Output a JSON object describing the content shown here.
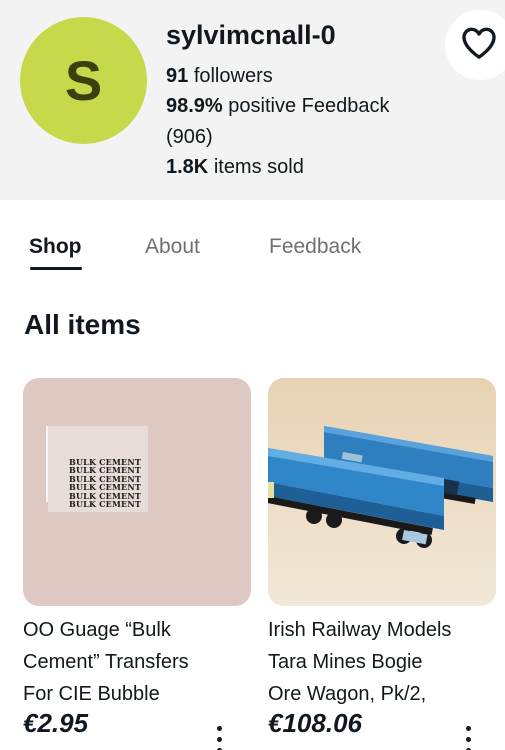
{
  "seller": {
    "avatar_initial": "S",
    "name": "sylvimcnall-0",
    "followers_count": "91",
    "followers_label": "followers",
    "feedback_percent": "98.9%",
    "feedback_label": "positive Feedback",
    "feedback_count": "(906)",
    "items_sold_count": "1.8K",
    "items_sold_label": "items sold",
    "follow_icon": "heart-outline-icon"
  },
  "tabs": [
    {
      "label": "Shop",
      "active": true
    },
    {
      "label": "About",
      "active": false
    },
    {
      "label": "Feedback",
      "active": false
    }
  ],
  "section_title": "All items",
  "listings": [
    {
      "title_line1": "OO Guage “Bulk",
      "title_line2": "Cement” Transfers",
      "title_line3": "For CIE Bubble",
      "price": "€2.95",
      "image_text": [
        "BULK CEMENT",
        "BULK CEMENT",
        "BULK CEMENT",
        "BULK CEMENT",
        "BULK CEMENT",
        "BULK CEMENT"
      ]
    },
    {
      "title_line1": "Irish Railway Models",
      "title_line2": "Tara Mines Bogie",
      "title_line3": "Ore Wagon, Pk/2,",
      "price": "€108.06",
      "image_desc": "two blue ore wagons"
    }
  ],
  "colors": {
    "avatar_bg": "#c5d94a",
    "header_bg": "#f3f3f3",
    "wagon_blue": "#2f7fc0"
  }
}
